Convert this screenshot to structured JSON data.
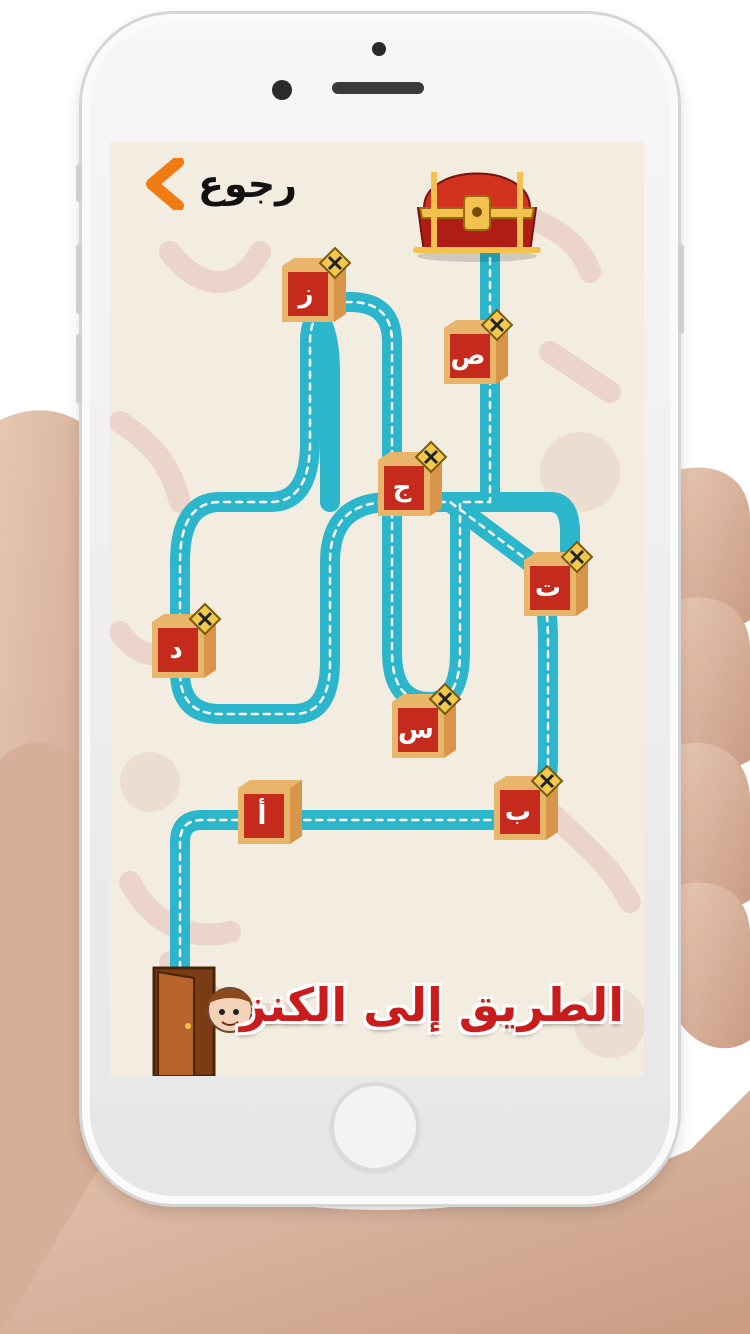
{
  "screen": {
    "back_label": "رجوع",
    "title": "الطريق إلى الكنز"
  },
  "levels": [
    {
      "letter": "أ",
      "locked": false
    },
    {
      "letter": "ب",
      "locked": true
    },
    {
      "letter": "س",
      "locked": true
    },
    {
      "letter": "د",
      "locked": true
    },
    {
      "letter": "ت",
      "locked": true
    },
    {
      "letter": "ج",
      "locked": true
    },
    {
      "letter": "ص",
      "locked": true
    },
    {
      "letter": "ز",
      "locked": true
    }
  ],
  "colors": {
    "road": "#2bb6cc",
    "block_red": "#c42b1c",
    "block_tan": "#e8b56a",
    "title_red": "#c91c1c",
    "back_arrow": "#f07b12"
  },
  "icons": [
    "chevron-left-icon",
    "treasure-chest-icon",
    "lock-tools-icon",
    "door-icon",
    "boy-peeking-icon"
  ]
}
